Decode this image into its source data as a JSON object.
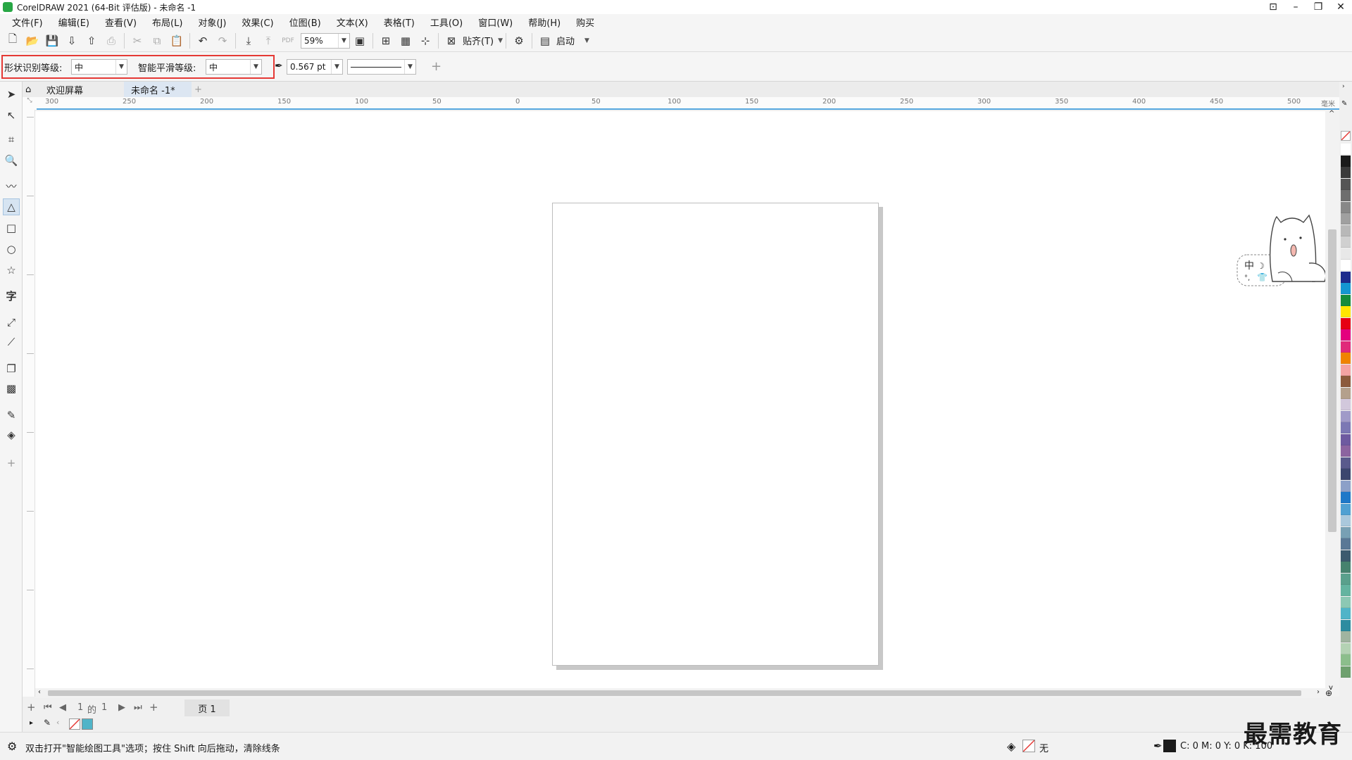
{
  "window": {
    "title": "CorelDRAW 2021 (64-Bit 评估版) - 未命名 -1"
  },
  "menu": [
    "文件(F)",
    "编辑(E)",
    "查看(V)",
    "布局(L)",
    "对象(J)",
    "效果(C)",
    "位图(B)",
    "文本(X)",
    "表格(T)",
    "工具(O)",
    "窗口(W)",
    "帮助(H)",
    "购买"
  ],
  "toolbar": {
    "zoom": "59%",
    "snap_label": "贴齐(T)",
    "launch_label": "启动",
    "pdf_label": "PDF"
  },
  "property_bar": {
    "shape_recognition_label": "形状识别等级:",
    "shape_recognition_value": "中",
    "smart_smoothing_label": "智能平滑等级:",
    "smart_smoothing_value": "中",
    "outline_width": "0.567 pt"
  },
  "tabs": [
    {
      "label": "欢迎屏幕"
    },
    {
      "label": "未命名 -1*"
    }
  ],
  "ruler": {
    "h_ticks": [
      "300",
      "250",
      "200",
      "150",
      "100",
      "50",
      "0",
      "50",
      "100",
      "150",
      "200",
      "250",
      "300",
      "350",
      "400",
      "450",
      "500"
    ],
    "unit": "毫米"
  },
  "page_nav": {
    "current": "1",
    "of": "的",
    "total": "1",
    "page_tab": "页 1"
  },
  "status": {
    "hint": "双击打开\"智能绘图工具\"选项；按住 Shift 向后拖动，清除线条",
    "fill": "无",
    "outline": "C: 0 M: 0 Y: 0 K: 100"
  },
  "mascot": {
    "text": "中"
  },
  "watermark": "最需教育",
  "colors": {
    "accent": "#56a8e0",
    "highlight": "#e53935"
  },
  "palette": [
    "#ffffff",
    "#1a1a1a",
    "#3a3a3a",
    "#555555",
    "#6e6e6e",
    "#888888",
    "#a0a0a0",
    "#b8b8b8",
    "#d0d0d0",
    "#e8e8e8",
    "#ffffff",
    "#1e2c8c",
    "#1496d2",
    "#148c3c",
    "#ffe600",
    "#e60012",
    "#e4007f",
    "#e0297a",
    "#f08300",
    "#f4a3a3",
    "#8c5a3c",
    "#b4a08c",
    "#d2c8dc",
    "#a09ac8",
    "#7c78b4",
    "#6e5aa0",
    "#8c64a0",
    "#5a5a8c",
    "#3c466e",
    "#8ca0c8",
    "#1e78c8",
    "#50a0d2",
    "#aac8dc",
    "#78a0b4",
    "#5a7896",
    "#3c5a6e",
    "#46826e",
    "#5aa08c",
    "#64b4a0",
    "#8cc8b4",
    "#50b4c8",
    "#2d8ca0",
    "#a0b4a0",
    "#b4d2b4",
    "#8cbe8c",
    "#6ea06e"
  ]
}
